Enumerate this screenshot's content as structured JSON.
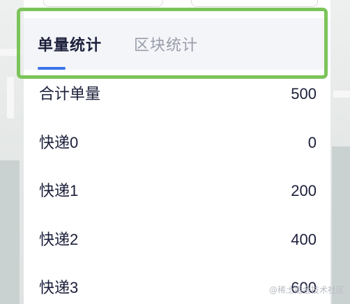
{
  "tabs": [
    {
      "label": "单量统计",
      "active": true
    },
    {
      "label": "区块统计",
      "active": false
    }
  ],
  "rows": [
    {
      "label": "合计单量",
      "value": "500"
    },
    {
      "label": "快递0",
      "value": "0"
    },
    {
      "label": "快递1",
      "value": "200"
    },
    {
      "label": "快递2",
      "value": "400"
    },
    {
      "label": "快递3",
      "value": "600"
    }
  ],
  "watermark": "@稀土掘金技术社区",
  "colors": {
    "accent": "#3a73e8",
    "highlight": "#7cc45a",
    "text": "#1b1f3a",
    "muted": "#9a9ca8"
  }
}
